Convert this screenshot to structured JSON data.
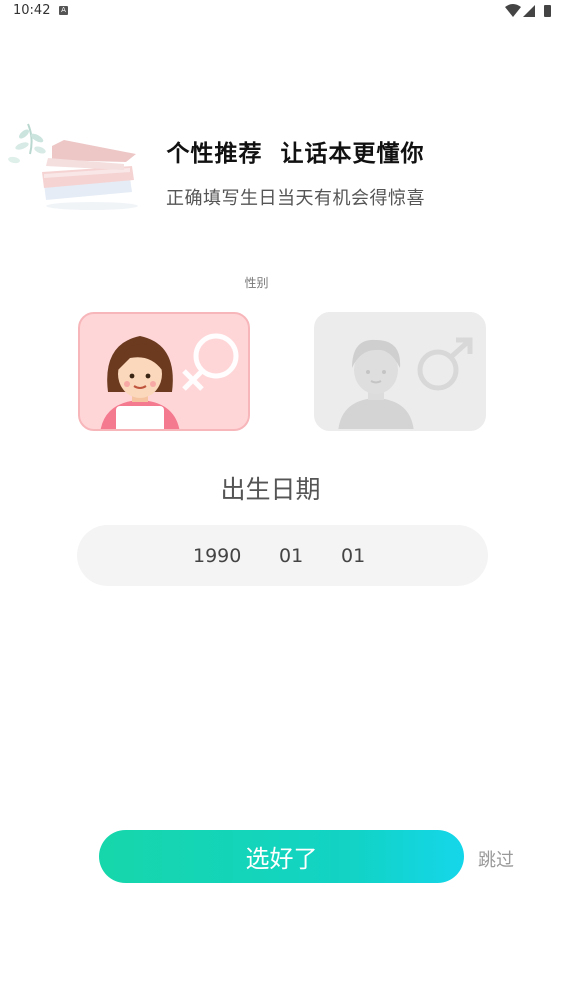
{
  "status_bar": {
    "time": "10:42",
    "notification_icon": "a-box-icon",
    "icons": [
      "wifi-icon",
      "signal-icon",
      "battery-icon"
    ]
  },
  "header": {
    "title": "个性推荐  让话本更懂你",
    "subtitle": "正确填写生日当天有机会得惊喜"
  },
  "gender": {
    "label": "性别",
    "options": [
      {
        "id": "female",
        "icon": "female-avatar-icon",
        "symbol": "female-symbol-icon",
        "selected": true
      },
      {
        "id": "male",
        "icon": "male-avatar-icon",
        "symbol": "male-symbol-icon",
        "selected": false
      }
    ]
  },
  "birthday": {
    "label": "出生日期",
    "year": "1990",
    "month": "01",
    "day": "01"
  },
  "actions": {
    "confirm_label": "选好了",
    "skip_label": "跳过"
  },
  "colors": {
    "accent_start": "#16d6ab",
    "accent_end": "#14d6ea",
    "female_card": "#ffd6d8",
    "male_card": "#ececec"
  }
}
